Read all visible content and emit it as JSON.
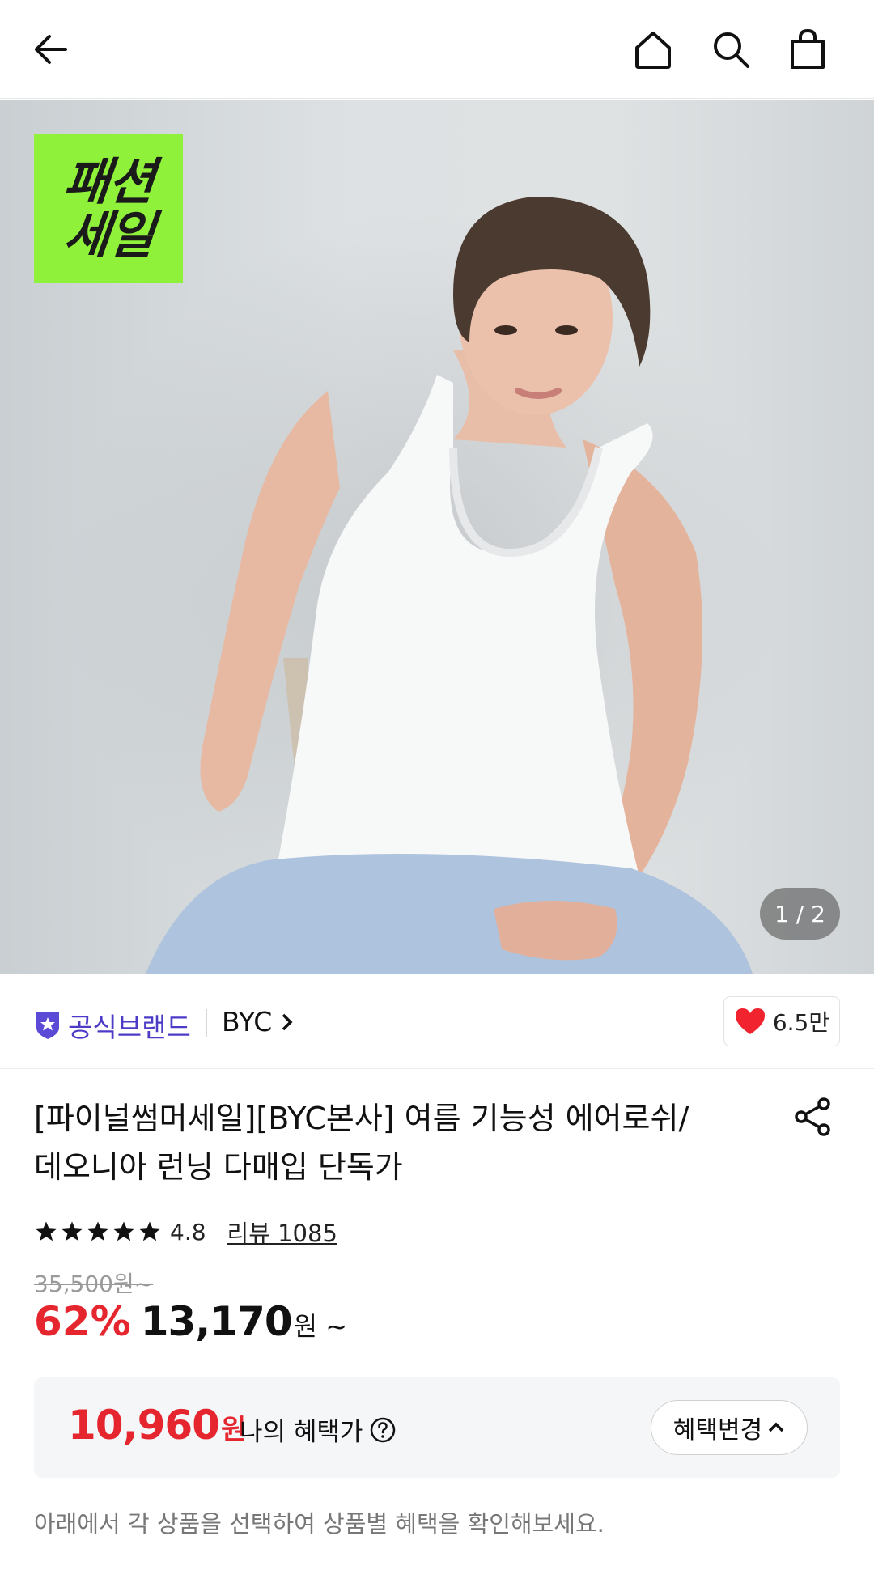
{
  "header": {
    "back_icon": "arrow-left-icon",
    "home_icon": "home-icon",
    "search_icon": "search-icon",
    "cart_icon": "shopping-bag-icon"
  },
  "hero": {
    "badge_line1": "패션",
    "badge_line2": "세일",
    "badge_color": "#8ff13a",
    "page_counter": "1 / 2"
  },
  "brand": {
    "official_label": "공식브랜드",
    "official_color": "#4b3bc7",
    "name": "BYC",
    "likes": "6.5만"
  },
  "product": {
    "title_line1": "[파이널썸머세일][BYC본사] 여름 기능성 에어로쉬/",
    "title_line2": "데오니아 런닝 다매입 단독가",
    "rating": "4.8",
    "review_link": "리뷰 1085",
    "original_price": "35,500원~",
    "discount": "62%",
    "price": "13,170",
    "price_unit": "원 ~"
  },
  "benefit": {
    "price": "10,960",
    "won": "원",
    "label": "나의 혜택가",
    "change_button": "혜택변경"
  },
  "notice": "아래에서 각 상품을 선택하여 상품별 혜택을 확인해보세요."
}
